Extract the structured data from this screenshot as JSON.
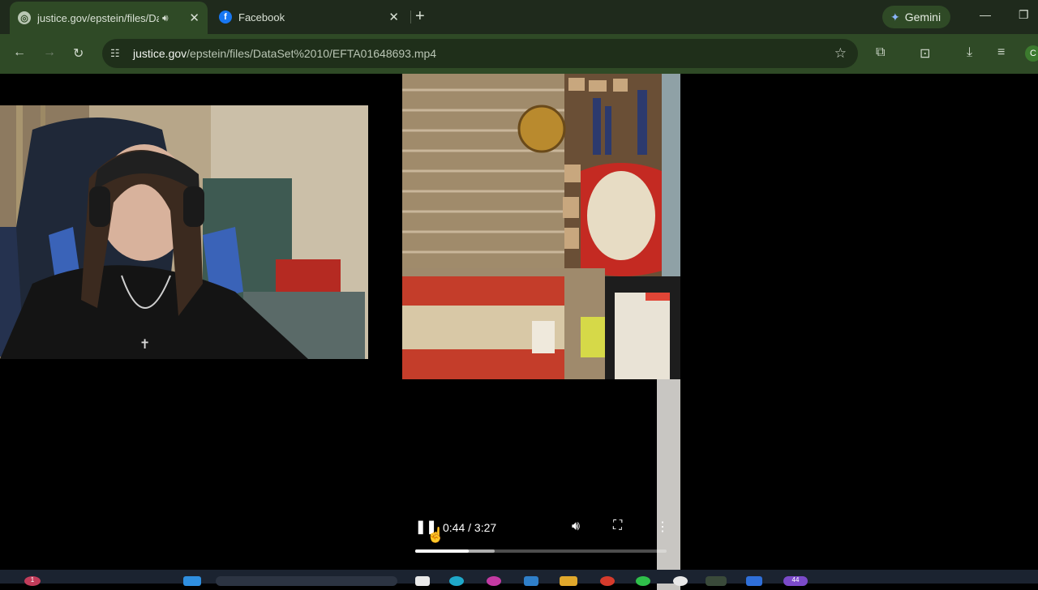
{
  "tabs": [
    {
      "title": "justice.gov/epstein/files/Da",
      "active": true,
      "favicon": "globe-icon",
      "audio": true
    },
    {
      "title": "Facebook",
      "active": false,
      "favicon": "facebook-icon",
      "audio": false
    }
  ],
  "gemini": {
    "label": "Gemini"
  },
  "omnibox": {
    "url_host": "justice.gov",
    "url_path": "/epstein/files/DataSet%2010/EFTA01648693.mp4"
  },
  "profile": {
    "initial": "C"
  },
  "player": {
    "time": "0:44 / 3:27",
    "played_fraction": 0.212,
    "buffered_fraction": 0.315
  },
  "taskbar": {
    "badges": [
      "1",
      "44"
    ]
  },
  "colors": {
    "tab_strip": "#1f2a1c",
    "toolbar": "#2f4a26",
    "content": "#000000"
  }
}
